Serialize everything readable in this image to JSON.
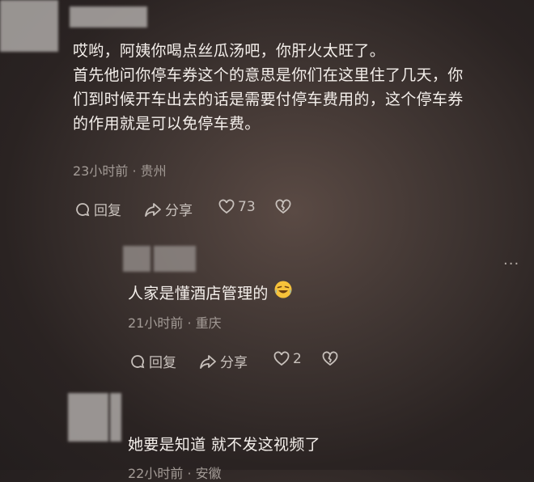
{
  "comment1": {
    "lines": [
      "哎哟，阿姨你喝点丝瓜汤吧，你肝火太旺了。",
      "首先他问你停车券这个的意思是你们在这里住了几天，你",
      "们到时候开车出去的话是需要付停车费用的，这个停车券",
      "的作用就是可以免停车费。"
    ],
    "meta": "23小时前 · 贵州",
    "reply_label": "回复",
    "share_label": "分享",
    "like_count": "73"
  },
  "comment2": {
    "text": "人家是懂酒店管理的",
    "emoji": "laughing-crying-emoji",
    "meta": "21小时前 · 重庆",
    "reply_label": "回复",
    "share_label": "分享",
    "like_count": "2",
    "more_label": "···"
  },
  "comment3": {
    "text": "她要是知道 就不发这视频了",
    "meta_partial": "22小时前 · 安徽"
  }
}
